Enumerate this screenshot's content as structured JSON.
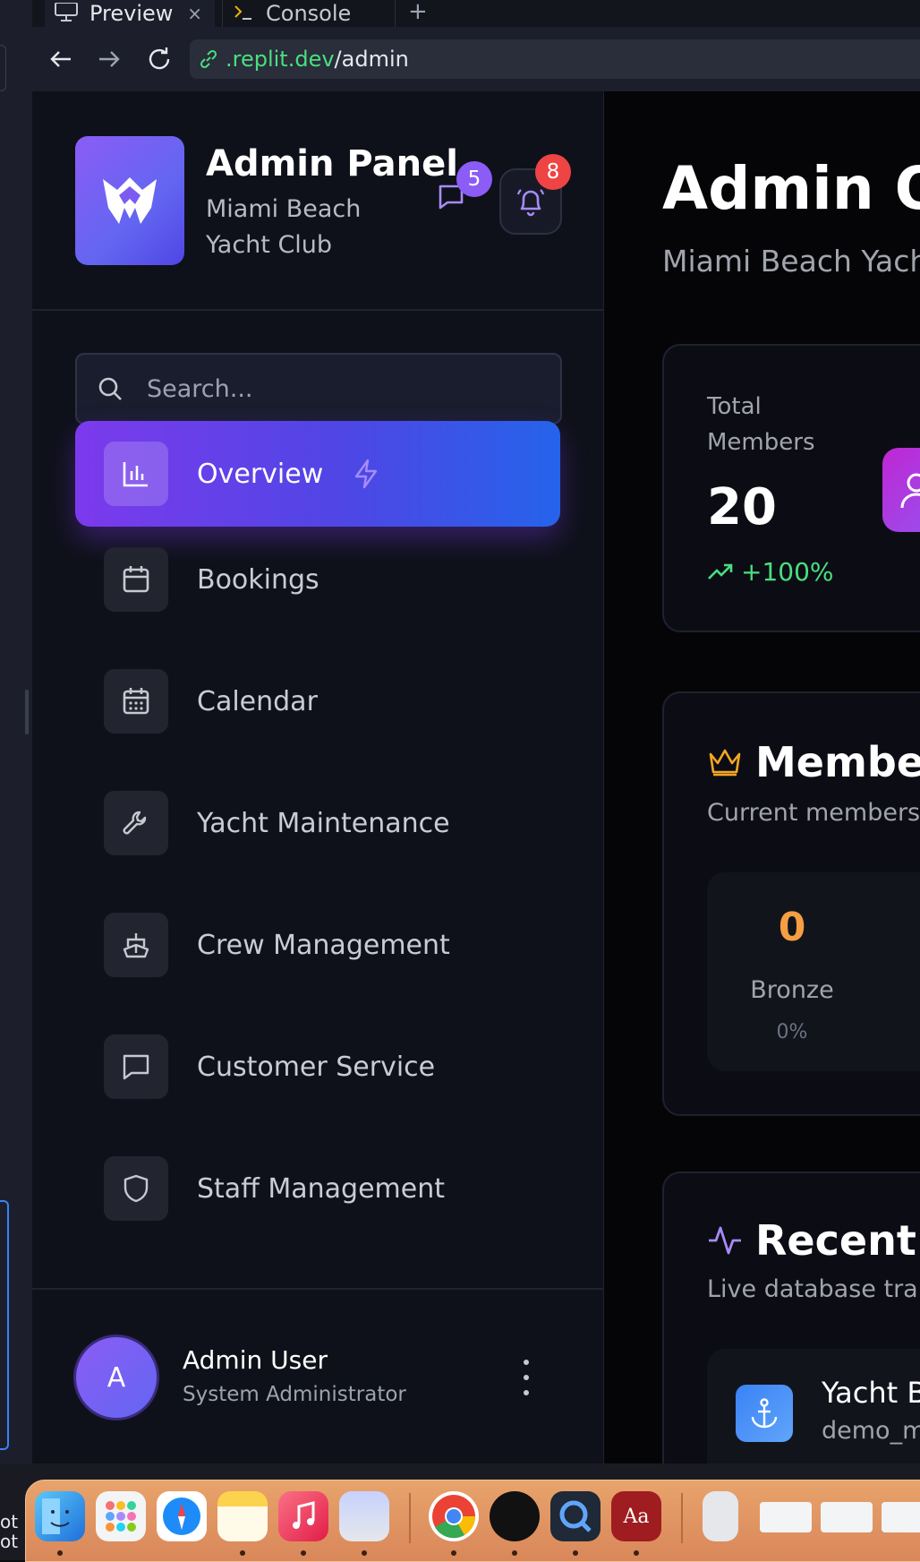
{
  "browser": {
    "tabs": [
      {
        "label": "Preview",
        "active": true
      },
      {
        "label": "Console",
        "active": false
      }
    ],
    "new_tab": "+",
    "close_glyph": "×",
    "url": {
      "domain": ".replit.dev",
      "path": "/admin"
    }
  },
  "sidebar": {
    "brand": {
      "title": "Admin Panel",
      "subtitle": "Miami Beach Yacht Club"
    },
    "messages_badge": "5",
    "notifications_badge": "8",
    "search_placeholder": "Search...",
    "nav": [
      {
        "label": "Overview",
        "icon": "bar-chart-icon",
        "active": true
      },
      {
        "label": "Bookings",
        "icon": "calendar-icon"
      },
      {
        "label": "Calendar",
        "icon": "calendar-grid-icon"
      },
      {
        "label": "Yacht Maintenance",
        "icon": "wrench-icon"
      },
      {
        "label": "Crew Management",
        "icon": "ship-icon"
      },
      {
        "label": "Customer Service",
        "icon": "message-square-icon"
      },
      {
        "label": "Staff Management",
        "icon": "shield-icon"
      }
    ],
    "user": {
      "initial": "A",
      "name": "Admin User",
      "role": "System Administrator"
    }
  },
  "main": {
    "title": "Admin Ov",
    "subtitle": "Miami Beach Yach",
    "stats": [
      {
        "label": "Total Members",
        "value": "20",
        "change": "+100%"
      }
    ],
    "membership": {
      "title": "Members",
      "subtitle": "Current membersh",
      "tiers": [
        {
          "count": "0",
          "name": "Bronze",
          "percent": "0%"
        }
      ]
    },
    "recent": {
      "title": "Recent A",
      "subtitle": "Live database tran",
      "items": [
        {
          "title": "Yacht B",
          "subtitle": "demo_m"
        }
      ]
    }
  },
  "desktop_text": "ot\not",
  "colors": {
    "accent_start": "#7c3aed",
    "accent_end": "#2563eb",
    "positive": "#4ade80",
    "badge_red": "#ef4444",
    "badge_purple": "#8b5cf6",
    "bronze": "#f59e42"
  }
}
